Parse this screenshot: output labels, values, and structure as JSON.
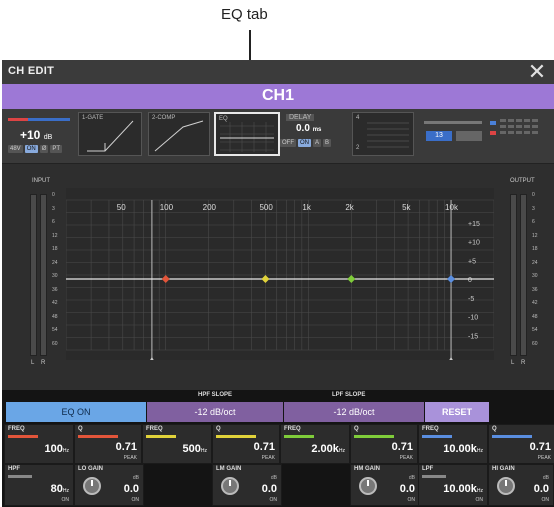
{
  "annotation": {
    "label": "EQ tab"
  },
  "window": {
    "title": "CH EDIT",
    "close_glyph": "✕"
  },
  "channel": {
    "name": "CH1"
  },
  "strip": {
    "gain": {
      "value": "+10",
      "unit": "dB"
    },
    "gain_toggles": [
      "48V",
      "ON",
      "Ø",
      "PT"
    ],
    "modules": [
      "1-GATE",
      "2-COMP",
      "EQ"
    ],
    "delay": {
      "label": "DELAY",
      "value": "0.0",
      "unit": "ms",
      "toggles": [
        "OFF",
        "ON",
        "A",
        "B"
      ]
    },
    "module4_marks": [
      "4",
      "2"
    ],
    "bus_value": "13"
  },
  "graph": {
    "input_label": "INPUT",
    "output_label": "OUTPUT",
    "freq_labels": [
      "50",
      "100",
      "200",
      "500",
      "1k",
      "2k",
      "5k",
      "10k"
    ],
    "db_labels": [
      "+15",
      "+10",
      "+5",
      "0",
      "-5",
      "-10",
      "-15"
    ],
    "meter_scale": [
      "0",
      "3",
      "6",
      "12",
      "18",
      "24",
      "30",
      "36",
      "42",
      "48",
      "54",
      "60"
    ],
    "lr": [
      "L",
      "R"
    ],
    "band_colors": [
      "#e2553a",
      "#e0d23a",
      "#7fcc3a",
      "#5a8ee0"
    ],
    "line_color": "#e8e8e8"
  },
  "controls": {
    "eq_on": "EQ ON",
    "hpf_slope_label": "HPF SLOPE",
    "hpf_slope_value": "-12 dB/oct",
    "lpf_slope_label": "LPF SLOPE",
    "lpf_slope_value": "-12 dB/oct",
    "reset": "RESET"
  },
  "bands": [
    {
      "freq_label": "FREQ",
      "freq": "100",
      "freq_unit": "Hz",
      "q_label": "Q",
      "q": "0.71",
      "peak": "PEAK",
      "color": "#e2553a"
    },
    {
      "freq_label": "FREQ",
      "freq": "500",
      "freq_unit": "Hz",
      "q_label": "Q",
      "q": "0.71",
      "peak": "PEAK",
      "color": "#e0d23a"
    },
    {
      "freq_label": "FREQ",
      "freq": "2.00k",
      "freq_unit": "Hz",
      "q_label": "Q",
      "q": "0.71",
      "peak": "PEAK",
      "color": "#7fcc3a"
    },
    {
      "freq_label": "FREQ",
      "freq": "10.00k",
      "freq_unit": "Hz",
      "q_label": "Q",
      "q": "0.71",
      "peak": "PEAK",
      "color": "#5a8ee0"
    }
  ],
  "gain_row": [
    {
      "kind": "filter",
      "label": "HPF",
      "value": "80",
      "unit": "Hz",
      "on": "ON"
    },
    {
      "kind": "gain",
      "label": "LO GAIN",
      "value": "0.0",
      "unit": "dB",
      "on": "ON"
    },
    {
      "kind": "gain",
      "label": "LM GAIN",
      "value": "0.0",
      "unit": "dB",
      "on": "ON"
    },
    {
      "kind": "gain",
      "label": "HM GAIN",
      "value": "0.0",
      "unit": "dB",
      "on": "ON"
    },
    {
      "kind": "filter",
      "label": "LPF",
      "value": "10.00k",
      "unit": "Hz",
      "on": "ON"
    },
    {
      "kind": "gain",
      "label": "HI GAIN",
      "value": "0.0",
      "unit": "dB",
      "on": "ON"
    }
  ]
}
